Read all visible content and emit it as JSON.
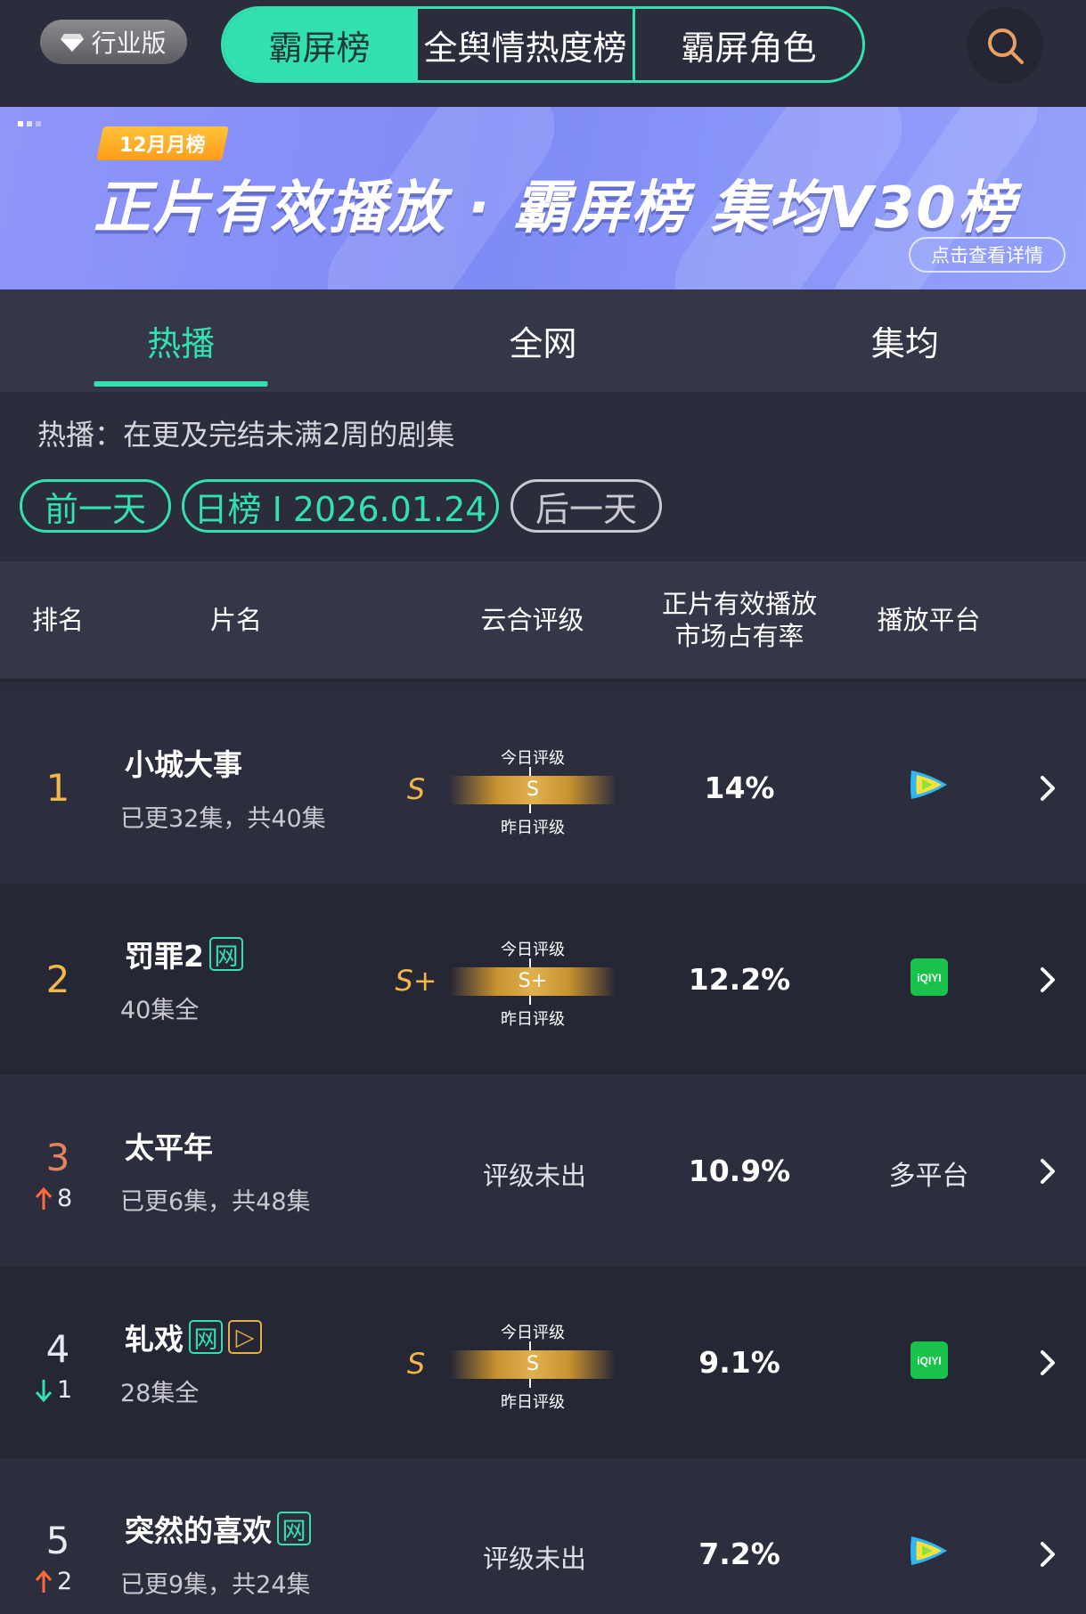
{
  "header": {
    "edition_label": "行业版",
    "tabs": [
      "霸屏榜",
      "全舆情热度榜",
      "霸屏角色"
    ],
    "active_tab": 0
  },
  "banner": {
    "badge": "12月月榜",
    "title": "正片有效播放 · 霸屏榜 集均V30榜",
    "detail_button": "点击查看详情"
  },
  "subtabs": [
    "热播",
    "全网",
    "集均"
  ],
  "description": "热播：在更及完结未满2周的剧集",
  "date_controls": {
    "prev": "前一天",
    "current": "日榜 I 2026.01.24",
    "next": "后一天"
  },
  "table_headers": {
    "rank": "排名",
    "title": "片名",
    "grade": "云合评级",
    "share_line1": "正片有效播放",
    "share_line2": "市场占有率",
    "platform": "播放平台"
  },
  "grade_labels": {
    "today": "今日评级",
    "yesterday": "昨日评级"
  },
  "rows": [
    {
      "rank": "1",
      "delta": "",
      "title": "小城大事",
      "tags": [],
      "episodes": "已更32集，共40集",
      "grade_left": "S",
      "grade_today": "S",
      "pending": "",
      "share": "14%",
      "platform": "tencent",
      "platform_text": ""
    },
    {
      "rank": "2",
      "delta": "",
      "title": "罚罪2",
      "tags": [
        "网"
      ],
      "episodes": "40集全",
      "grade_left": "S+",
      "grade_today": "S+",
      "pending": "",
      "share": "12.2%",
      "platform": "iqiyi",
      "platform_text": ""
    },
    {
      "rank": "3",
      "delta": "8",
      "delta_dir": "up",
      "title": "太平年",
      "tags": [],
      "episodes": "已更6集，共48集",
      "grade_left": "",
      "grade_today": "",
      "pending": "评级未出",
      "share": "10.9%",
      "platform": "multi",
      "platform_text": "多平台"
    },
    {
      "rank": "4",
      "delta": "1",
      "delta_dir": "down",
      "title": "轧戏",
      "tags": [
        "网",
        "▷"
      ],
      "episodes": "28集全",
      "grade_left": "S",
      "grade_today": "S",
      "pending": "",
      "share": "9.1%",
      "platform": "iqiyi",
      "platform_text": ""
    },
    {
      "rank": "5",
      "delta": "2",
      "delta_dir": "up",
      "title": "突然的喜欢",
      "tags": [
        "网"
      ],
      "episodes": "已更9集，共24集",
      "grade_left": "",
      "grade_today": "",
      "pending": "评级未出",
      "share": "7.2%",
      "platform": "tencent",
      "platform_text": ""
    }
  ],
  "platform_logo_text": {
    "iqiyi": "iQIYI"
  },
  "colors": {
    "accent": "#33e0b0",
    "rank_gold": "#f0b74a",
    "rank_copper": "#e4845e",
    "rank_plain": "#e8e8ee",
    "up": "#ff6a3d",
    "down": "#33e0b0"
  }
}
